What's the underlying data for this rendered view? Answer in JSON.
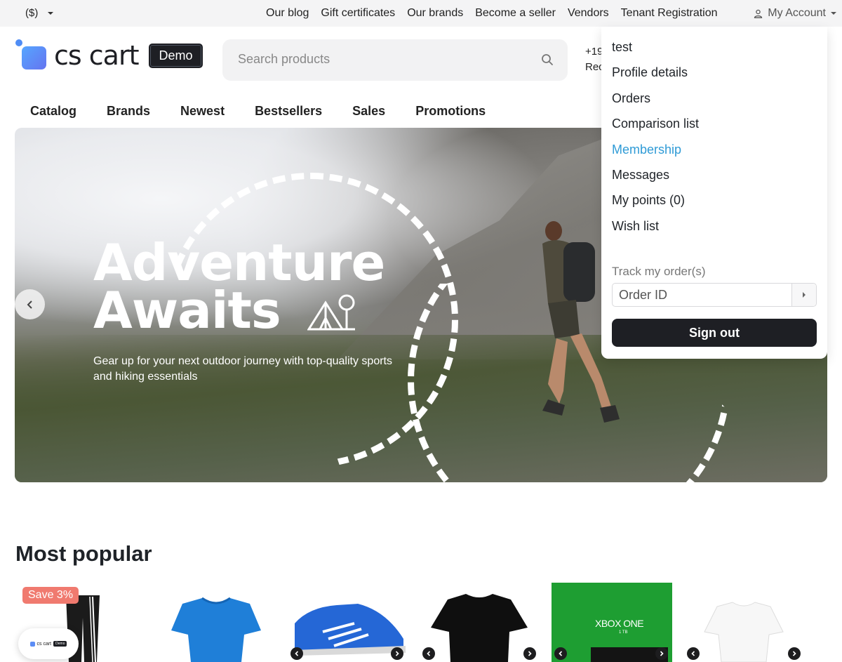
{
  "topbar": {
    "currency": "($)",
    "links": [
      "Our blog",
      "Gift certificates",
      "Our brands",
      "Become a seller",
      "Vendors",
      "Tenant Registration"
    ],
    "account_label": "My Account"
  },
  "header": {
    "logo_text": "cs cart",
    "demo_badge": "Demo",
    "search_placeholder": "Search products",
    "phone_partial": "+19",
    "phone_partial_2": "Rec"
  },
  "nav": {
    "items": [
      "Catalog",
      "Brands",
      "Newest",
      "Bestsellers",
      "Sales",
      "Promotions"
    ]
  },
  "banner": {
    "title_line1": "Adventure",
    "title_line2": "Awaits",
    "subtitle": "Gear up for your next outdoor journey with top-quality sports and hiking essentials"
  },
  "popular": {
    "title": "Most popular",
    "save_badge": "Save 3%",
    "xbox_label": "XBOX ONE",
    "xbox_sub": "1 TB",
    "mini_logo": "cs cart",
    "mini_badge": "Demo"
  },
  "account_menu": {
    "items": [
      "test",
      "Profile details",
      "Orders",
      "Comparison list",
      "Membership",
      "Messages",
      "My points (0)",
      "Wish list"
    ],
    "active_item": "Membership",
    "track_label": "Track my order(s)",
    "order_placeholder": "Order ID",
    "sign_out": "Sign out"
  },
  "colors": {
    "accent_link": "#2f9bd6",
    "button_dark": "#1e1f24",
    "save_badge": "#f07a6f",
    "topbar_bg": "#f4f4f5"
  },
  "icons": [
    "chevron-down-icon",
    "user-icon",
    "search-icon",
    "chevron-left-icon",
    "chevron-right-icon",
    "tent-icon"
  ]
}
